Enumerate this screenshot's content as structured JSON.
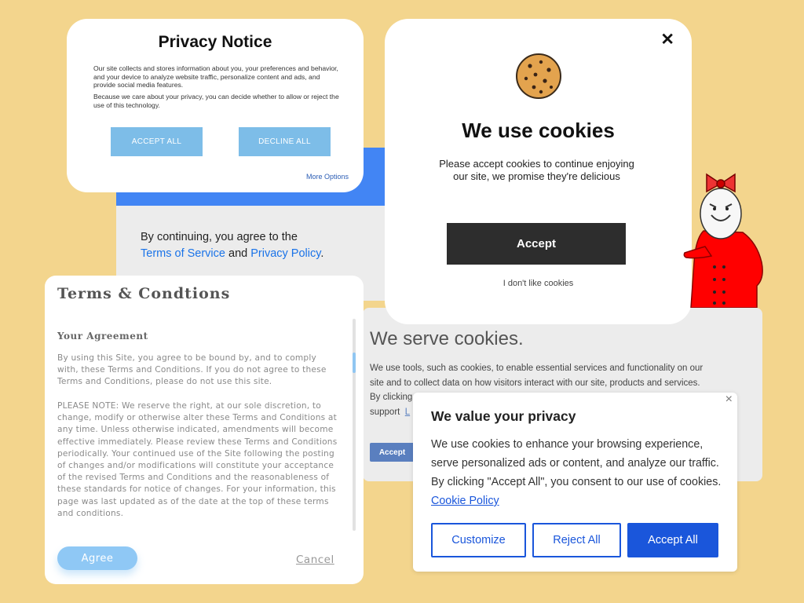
{
  "agree_panel": {
    "line1": "By continuing, you agree to the",
    "terms_link": "Terms of Service",
    "and": " and ",
    "privacy_link": "Privacy Policy",
    "period": "."
  },
  "privacy_notice": {
    "title": "Privacy Notice",
    "para1": "Our site collects and stores information about you, your preferences and behavior, and your device to analyze website traffic, personalize content and ads, and provide social media features.",
    "para2": "Because we care about your privacy, you can decide whether to allow or reject the use of this technology.",
    "accept_label": "ACCEPT ALL",
    "decline_label": "DECLINE ALL",
    "more_options": "More Options"
  },
  "cookie_modal": {
    "close_glyph": "✕",
    "title": "We use cookies",
    "message": "Please accept cookies to continue enjoying our site, we promise they're delicious",
    "accept_label": "Accept",
    "dislike_label": "I don't like cookies"
  },
  "serve_cookies": {
    "title": "We serve cookies.",
    "line1": "We use tools, such as cookies, to enable essential services and functionality on our",
    "line2": "site and to collect data on how visitors interact with our site, products and services.",
    "line3": "By clicking",
    "line4": "support",
    "line4_link": "L",
    "accept_label": "Accept"
  },
  "terms": {
    "title": "Terms & Condtions",
    "section": "Your Agreement",
    "para1": "By using this Site, you agree to be bound by, and to comply with, these Terms and Conditions. If you do not agree to these Terms and Conditions, please do not use this site.",
    "para2": "PLEASE NOTE: We reserve the right, at our sole discretion, to change, modify or otherwise alter these Terms and Conditions at any time. Unless otherwise indicated, amendments will become effective immediately. Please review these Terms and Conditions periodically. Your continued use of the Site following the posting of changes and/or modifications will constitute your acceptance of the revised Terms and Conditions and the reasonableness of these standards for notice of changes. For your information, this page was last updated as of the date at the top of these terms and conditions.",
    "agree_label": "Agree",
    "cancel_label": "Cancel"
  },
  "value_privacy": {
    "close_glyph": "×",
    "title": "We value your privacy",
    "body": "We use cookies to enhance your browsing experience, serve personalized ads or content, and analyze our traffic. By clicking \"Accept All\", you consent to our use of cookies. ",
    "policy_link": "Cookie Policy",
    "customize_label": "Customize",
    "reject_label": "Reject All",
    "accept_label": "Accept All"
  },
  "colors": {
    "background": "#f3d58d",
    "google_blue": "#4285f4",
    "privacy_button": "#7dbde8",
    "modal_accept": "#2d2d2d",
    "value_accent": "#1a56db",
    "chef_red": "#ff0000"
  },
  "icons": {
    "cookie": "cookie-icon",
    "mascot": "chef-egg-mascot"
  }
}
